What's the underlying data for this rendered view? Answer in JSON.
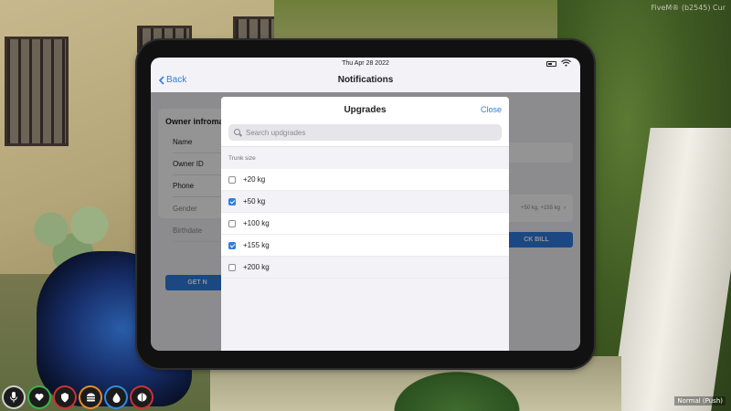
{
  "overlay": {
    "server_tag": "FiveM® (b2545) Cur",
    "mode_tag": "Normal (Push)"
  },
  "hud": {
    "icons": [
      "microphone-icon",
      "heart-icon",
      "shield-icon",
      "food-icon",
      "water-icon",
      "stress-icon"
    ]
  },
  "tablet": {
    "statusbar": {
      "date": "Thu Apr 28 2022"
    },
    "navbar": {
      "back_label": "Back",
      "title": "Notifications"
    },
    "owner": {
      "title": "Owner infroma",
      "rows": [
        "Name",
        "Owner ID",
        "Phone",
        "Gender",
        "Birthdate"
      ],
      "button": "GET N"
    },
    "side": {
      "upgrades_summary": "+50 kg, +155 kg",
      "bill_button": "CK BILL"
    },
    "modal": {
      "title": "Upgrades",
      "close_label": "Close",
      "search_placeholder": "Search updgrades",
      "section": "Trunk size",
      "options": [
        {
          "label": "+20 kg",
          "checked": false
        },
        {
          "label": "+50 kg",
          "checked": true
        },
        {
          "label": "+100 kg",
          "checked": false
        },
        {
          "label": "+155 kg",
          "checked": true
        },
        {
          "label": "+200 kg",
          "checked": false
        }
      ]
    }
  },
  "colors": {
    "accent": "#2f7de1",
    "background": "#f2f2f7"
  }
}
